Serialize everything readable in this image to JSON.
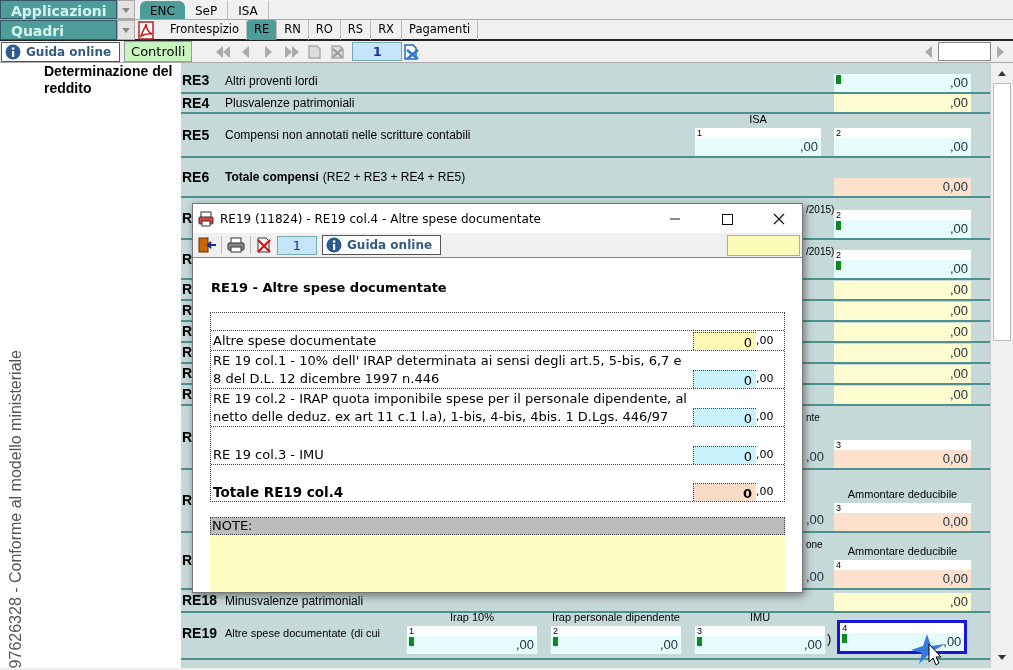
{
  "app_menu": {
    "applicazioni": "Applicazioni",
    "quadri": "Quadri"
  },
  "module_tabs": [
    {
      "label": "ENC",
      "selected": true
    },
    {
      "label": "SeP",
      "selected": false
    },
    {
      "label": "ISA",
      "selected": false
    }
  ],
  "section_tabs": [
    {
      "label": "Frontespizio",
      "selected": false
    },
    {
      "label": "RE",
      "selected": true
    },
    {
      "label": "RN",
      "selected": false
    },
    {
      "label": "RO",
      "selected": false
    },
    {
      "label": "RS",
      "selected": false
    },
    {
      "label": "RX",
      "selected": false
    },
    {
      "label": "Pagamenti",
      "selected": false
    }
  ],
  "toolbar": {
    "help": "Guida online",
    "checks": "Controlli",
    "page": "1"
  },
  "side_panel": {
    "section_title": "Determinazione del reddito",
    "vertical_note": "97626328 - Conforme al modello ministeriale"
  },
  "form_rows": [
    {
      "kind": "line",
      "code": "RE3",
      "label": "Altri proventi lordi",
      "field": {
        "color": "#e6fbfb",
        "marker": true,
        "value": ",00"
      }
    },
    {
      "kind": "line",
      "code": "RE4",
      "label": "Plusvalenze patrimoniali",
      "field": {
        "color": "#fdfbd0",
        "value": ",00"
      }
    },
    {
      "kind": "line",
      "code": "RE5",
      "label": "Compensi non annotati nelle scritture contabili",
      "mid": {
        "heading": "ISA",
        "num": "1",
        "color": "#e6fbfb",
        "value": ",00"
      },
      "field": {
        "num": "2",
        "color": "#e6fbfb",
        "value": ",00"
      }
    },
    {
      "kind": "line",
      "code": "RE6",
      "label": "Totale compensi",
      "note": "(RE2 + RE3 + RE4 + RE5)",
      "field": {
        "color": "#fde1cc",
        "value": "0,00"
      }
    },
    {
      "kind": "hidden",
      "code": "R",
      "tail": "/2015)",
      "field": {
        "num": "2",
        "marker": true,
        "color": "#e6fbfb",
        "value": ",00"
      }
    },
    {
      "kind": "hidden",
      "code": "R",
      "tail": "/2015)",
      "field": {
        "num": "2",
        "marker": true,
        "color": "#e6fbfb",
        "value": ",00"
      }
    },
    {
      "kind": "hidden",
      "code": "R",
      "field": {
        "color": "#fdfbd0",
        "value": ",00"
      }
    },
    {
      "kind": "hidden",
      "code": "R",
      "field": {
        "color": "#fdfbd0",
        "value": ",00"
      }
    },
    {
      "kind": "hidden",
      "code": "R",
      "field": {
        "color": "#fdfbd0",
        "value": ",00"
      }
    },
    {
      "kind": "hidden",
      "code": "R",
      "field": {
        "color": "#fdfbd0",
        "value": ",00"
      }
    },
    {
      "kind": "hidden",
      "code": "R",
      "field": {
        "color": "#fdfbd0",
        "value": ",00"
      }
    },
    {
      "kind": "hidden",
      "code": "R",
      "field": {
        "color": "#fdfbd0",
        "value": ",00"
      }
    },
    {
      "kind": "hidden",
      "code": "R",
      "tail": "nte",
      "stub": ",00",
      "field": {
        "num": "3",
        "color": "#fde1cc",
        "value": "0,00"
      }
    },
    {
      "kind": "hidden",
      "code": "R",
      "stub": ",00",
      "field": {
        "heading": "Ammontare deducibile",
        "num": "3",
        "color": "#fde1cc",
        "value": "0,00"
      }
    },
    {
      "kind": "hidden",
      "code": "R",
      "tail": "one",
      "stub": ",00",
      "field": {
        "heading": "Ammontare deducibile",
        "num": "4",
        "color": "#fde1cc",
        "value": "0,00"
      }
    },
    {
      "kind": "line",
      "code": "RE18",
      "label": "Minusvalenze patrimoniali",
      "field": {
        "color": "#fdfbd0",
        "value": ",00"
      }
    },
    {
      "kind": "multi",
      "code": "RE19",
      "label": "Altre spese documentate",
      "lead": "(di cui",
      "close": ")",
      "parts": [
        {
          "heading": "Irap 10%",
          "num": "1",
          "marker": true,
          "color": "#e6fbfb",
          "value": ",00",
          "selected": false
        },
        {
          "heading": "Irap personale dipendente",
          "num": "2",
          "marker": true,
          "color": "#e6fbfb",
          "value": ",00",
          "selected": false
        },
        {
          "heading": "IMU",
          "num": "3",
          "marker": true,
          "color": "#e6fbfb",
          "value": ",00",
          "selected": false
        },
        {
          "num": "4",
          "marker": true,
          "color": "#e6fbfb",
          "value": ",00",
          "selected": true
        }
      ]
    }
  ],
  "dialog": {
    "title": "RE19 (11824) - RE19 col.4 - Altre spese documentate",
    "page": "1",
    "help": "Guida online",
    "heading": "RE19 - Altre spese documentate",
    "lines": [
      {
        "kind": "entry",
        "color": "#fdf8b5",
        "label": "Altre spese documentate",
        "value": "0",
        "decimals": ",00"
      },
      {
        "kind": "entry",
        "color": "#c9f3fa",
        "label": "RE 19 col.1 - 10% dell' IRAP determinata ai sensi degli art.5, 5-bis, 6,7 e 8 del D.L. 12 dicembre 1997 n.446",
        "value": "0",
        "decimals": ",00"
      },
      {
        "kind": "entry",
        "color": "#c9f3fa",
        "label": "RE 19 col.2 - IRAP quota imponibile spese per il personale dipendente, al netto delle deduz. ex art 11 c.1 l.a), 1-bis, 4-bis, 4bis. 1 D.Lgs. 446/97",
        "value": "0",
        "decimals": ",00"
      },
      {
        "kind": "entry",
        "color": "#c9f3fa",
        "label": "RE 19 col.3 - IMU",
        "value": "0",
        "decimals": ",00"
      },
      {
        "kind": "total",
        "color": "#f9dcc8",
        "label": "Totale RE19 col.4",
        "value": "0",
        "decimals": ",00"
      }
    ],
    "notes_label": "NOTE:"
  }
}
